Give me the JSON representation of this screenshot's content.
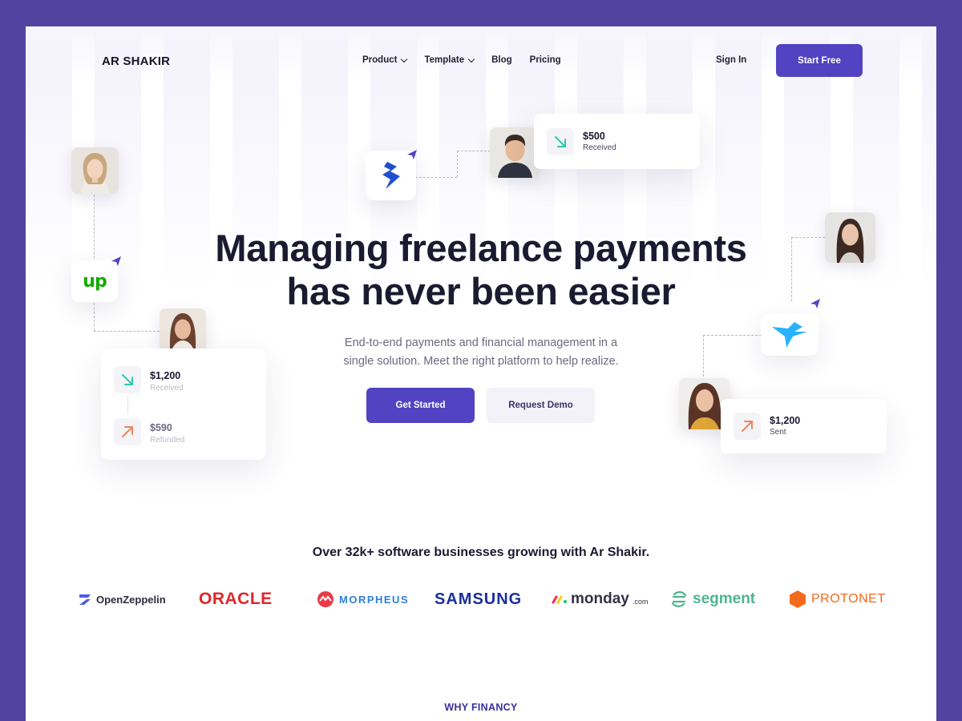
{
  "brand": {
    "logo": "AR SHAKIR"
  },
  "nav": {
    "items": [
      {
        "label": "Product",
        "dropdown": true
      },
      {
        "label": "Template",
        "dropdown": true
      },
      {
        "label": "Blog",
        "dropdown": false
      },
      {
        "label": "Pricing",
        "dropdown": false
      }
    ],
    "sign_in": "Sign In",
    "start_free": "Start Free"
  },
  "hero": {
    "title_line1": "Managing freelance payments",
    "title_line2": "has never been easier",
    "subtitle_line1": "End-to-end payments and financial management in a",
    "subtitle_line2": "single solution. Meet the right platform to help realize.",
    "primary_cta": "Get Started",
    "secondary_cta": "Request Demo"
  },
  "floating": {
    "top_card": {
      "amount": "$500",
      "status": "Received"
    },
    "left_card": {
      "rows": [
        {
          "amount": "$1,200",
          "status": "Received"
        },
        {
          "amount": "$590",
          "status": "Refunded"
        }
      ]
    },
    "right_card": {
      "amount": "$1,200",
      "status": "Sent"
    },
    "upwork_logo_text": "up"
  },
  "trust": {
    "headline": "Over 32k+ software businesses growing with Ar Shakir.",
    "logos": [
      "OpenZeppelin",
      "ORACLE",
      "MORPHEUS",
      "SAMSUNG",
      "monday",
      ".com",
      "segment",
      "PROTONET"
    ]
  },
  "section_label": "WHY FINANCY",
  "colors": {
    "frame": "#5243a0",
    "accent": "#5243c2",
    "received_arrow": "#2cc9b2",
    "sent_arrow": "#f0845e",
    "oracle": "#e0262b",
    "samsung": "#1b2f9c",
    "segment": "#4fb58f",
    "protonet": "#f26a1b",
    "morpheus": "#2e7fd9"
  }
}
